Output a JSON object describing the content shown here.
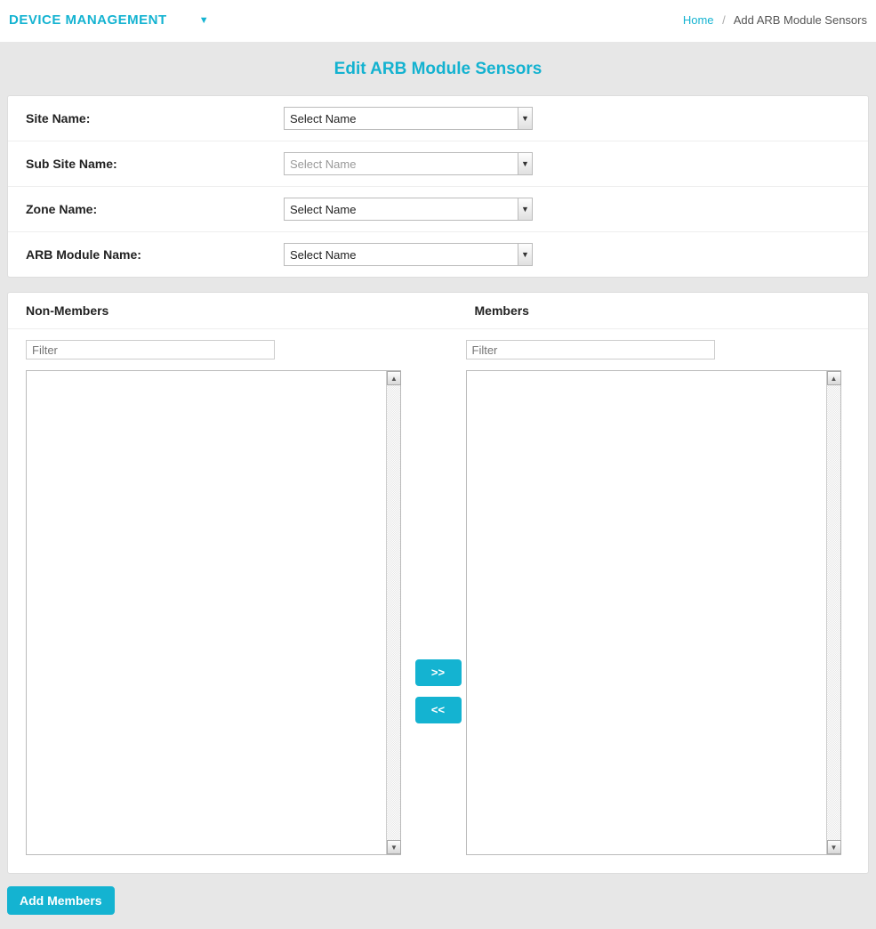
{
  "header": {
    "section_title": "DEVICE MANAGEMENT",
    "breadcrumb_home": "Home",
    "breadcrumb_current": "Add ARB Module Sensors"
  },
  "page": {
    "title": "Edit ARB Module Sensors"
  },
  "form": {
    "site_name_label": "Site Name:",
    "site_name_value": "Select Name",
    "sub_site_name_label": "Sub Site Name:",
    "sub_site_name_value": "Select Name",
    "zone_name_label": "Zone Name:",
    "zone_name_value": "Select Name",
    "arb_module_name_label": "ARB Module Name:",
    "arb_module_name_value": "Select Name"
  },
  "transfer": {
    "non_members_title": "Non-Members",
    "members_title": "Members",
    "filter_placeholder": "Filter",
    "move_right_label": ">>",
    "move_left_label": "<<"
  },
  "actions": {
    "add_members_label": "Add Members"
  }
}
